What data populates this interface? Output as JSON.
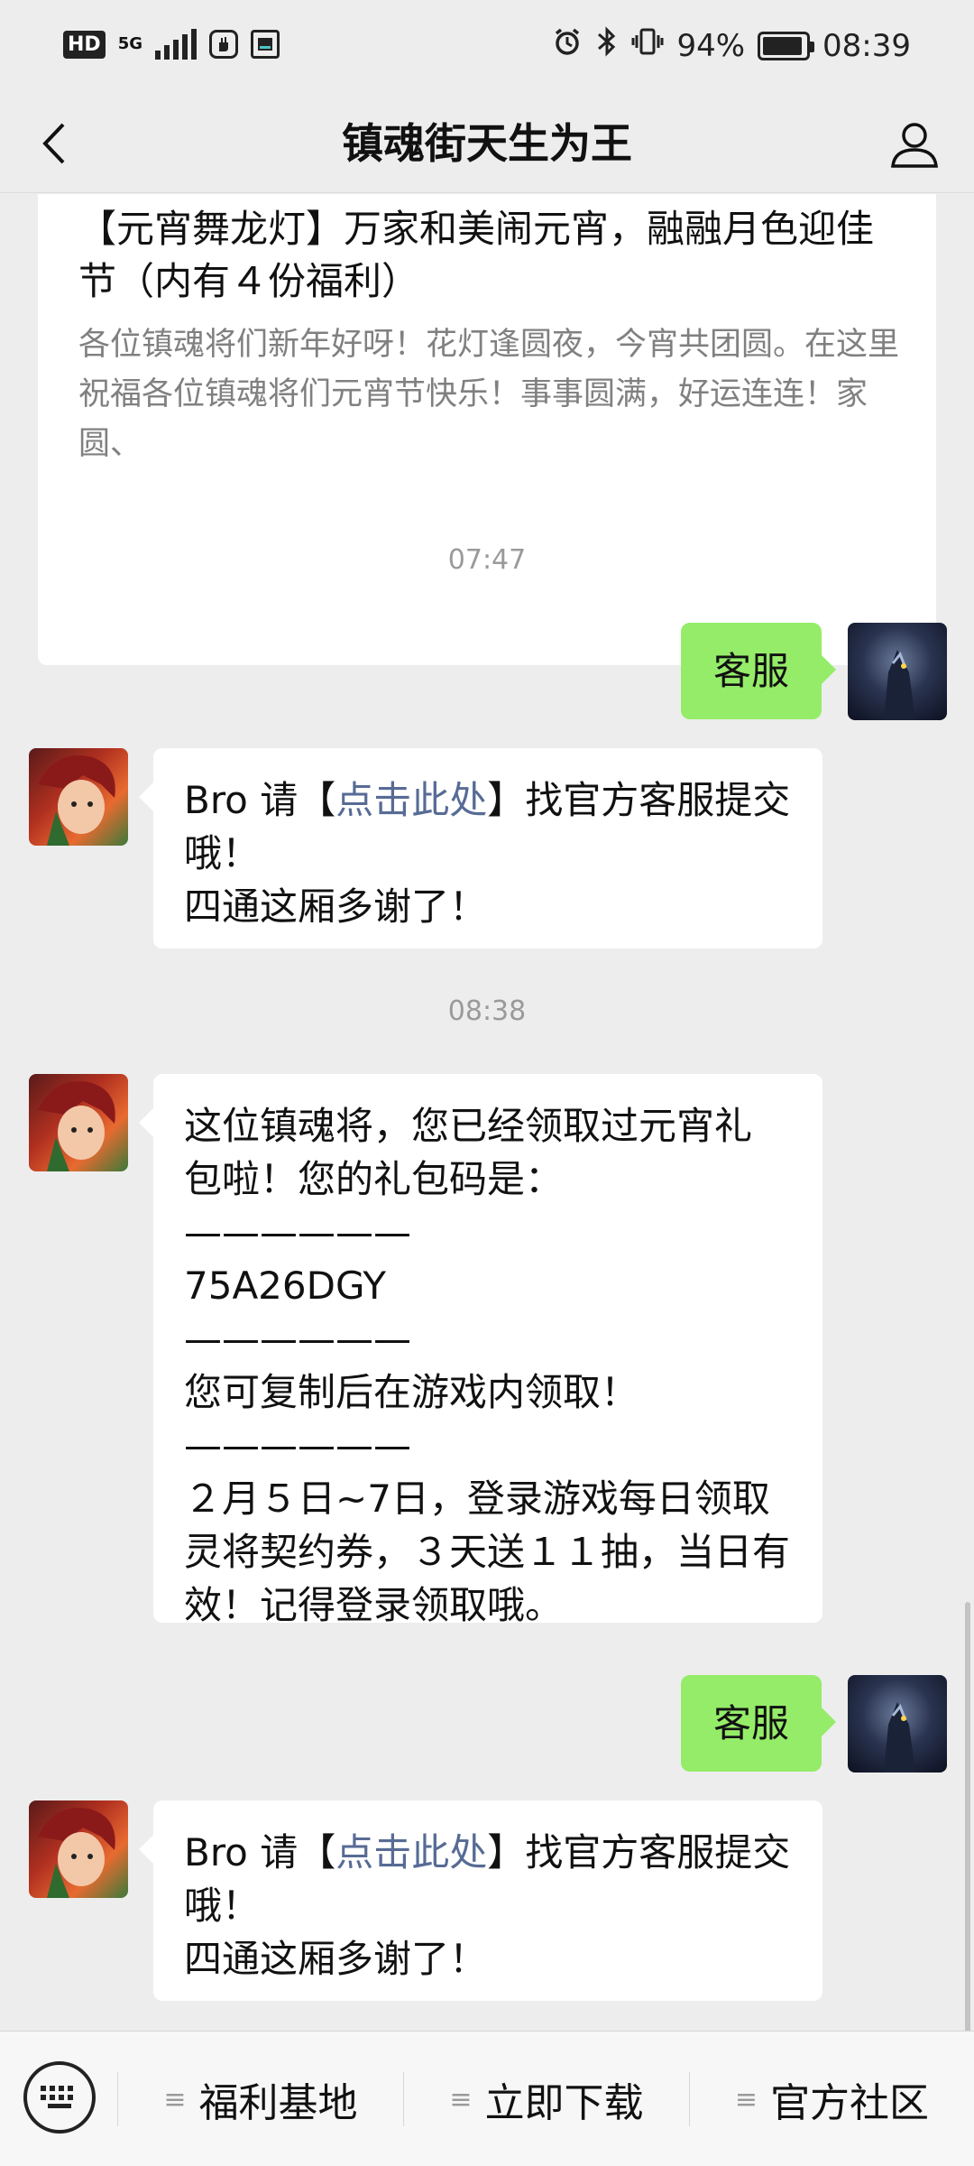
{
  "status_bar": {
    "hd": "HD",
    "network": "5G",
    "battery_percent_text": "94%",
    "battery_level": 0.94,
    "time": "08:39"
  },
  "header": {
    "title": "镇魂街天生为王"
  },
  "article": {
    "title": "【元宵舞龙灯】万家和美闹元宵，融融月色迎佳节（内有４份福利）",
    "digest": "各位镇魂将们新年好呀！花灯逢圆夜，今宵共团圆。在这里祝福各位镇魂将们元宵节快乐！事事圆满，好运连连！家圆、"
  },
  "messages": {
    "time1": "07:47",
    "me1": "客服",
    "bot1": {
      "prefix": "Bro 请【",
      "link": "点击此处",
      "suffix": "】找官方客服提交哦！",
      "line2": "四通这厢多谢了！"
    },
    "time2": "08:38",
    "bot2": {
      "l1": "这位镇魂将，您已经领取过元宵礼",
      "l2": "包啦！您的礼包码是：",
      "l3": "——————",
      "l4": "75A26DGY",
      "l5": "——————",
      "l6": "您可复制后在游戏内领取！",
      "l7": "——————",
      "l8": "２月５日~7日，登录游戏每日领取",
      "l9": "灵将契约券，３天送１１抽，当日有",
      "l10": "效！记得登录领取哦。"
    },
    "me2": "客服",
    "bot3": {
      "prefix": "Bro 请【",
      "link": "点击此处",
      "suffix": "】找官方客服提交哦！",
      "line2": "四通这厢多谢了！"
    }
  },
  "bottom_menu": {
    "items": [
      "福利基地",
      "立即下载",
      "官方社区"
    ]
  },
  "colors": {
    "background": "#ededed",
    "my_bubble": "#95ec69",
    "link": "#576b95"
  },
  "icons": [
    "keyboard-icon",
    "menu-list-icon",
    "back-arrow-icon",
    "person-icon",
    "alarm-icon",
    "bluetooth-icon",
    "vibrate-icon"
  ]
}
